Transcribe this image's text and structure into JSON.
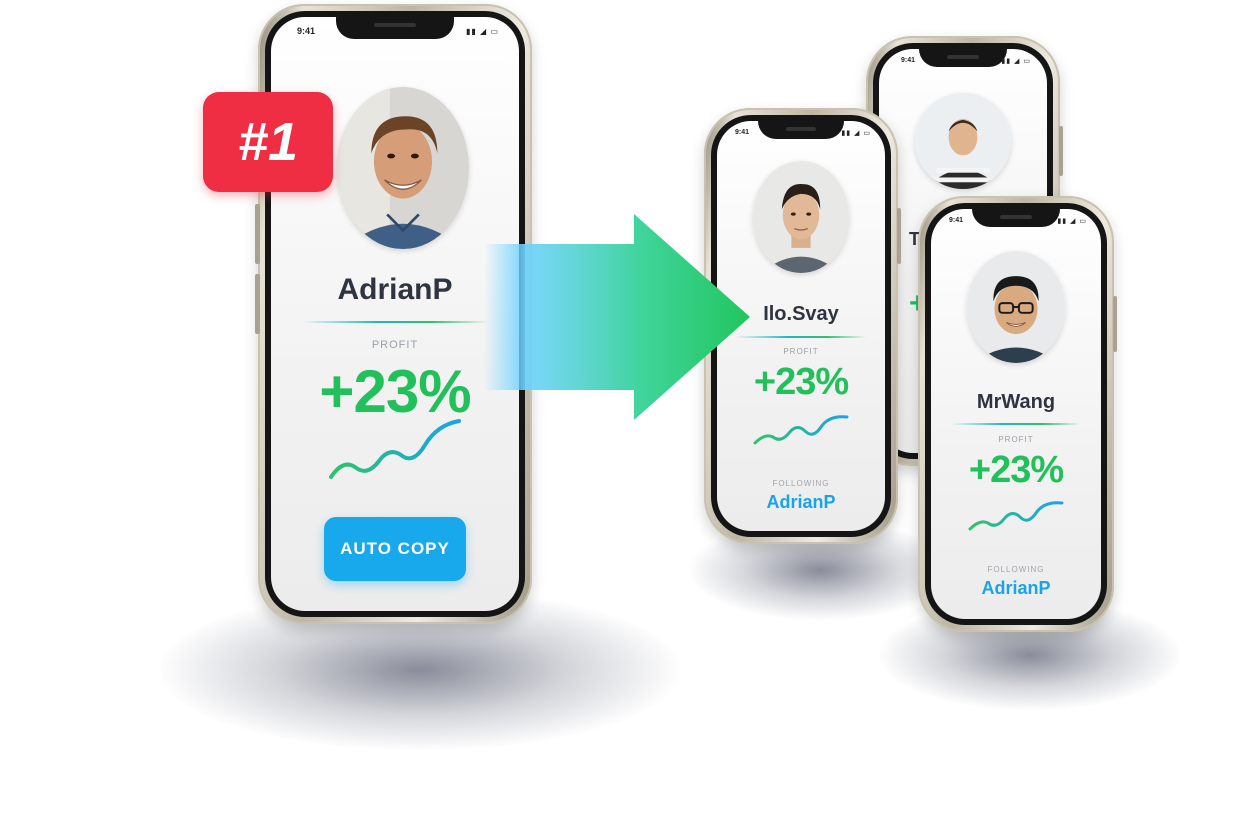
{
  "badge": {
    "label": "#1"
  },
  "status_time": "9:41",
  "leader": {
    "name": "AdrianP",
    "profit_label": "PROFIT",
    "profit_value": "+23%",
    "button_label": "AUTO COPY"
  },
  "followers": [
    {
      "name": "Ilo.Svay",
      "profit_label": "PROFIT",
      "profit_value": "+23%",
      "following_label": "FOLLOWING",
      "following_name": "AdrianP"
    },
    {
      "name": "T",
      "profit_value": "+"
    },
    {
      "name": "MrWang",
      "profit_label": "PROFIT",
      "profit_value": "+23%",
      "following_label": "FOLLOWING",
      "following_name": "AdrianP"
    }
  ],
  "colors": {
    "badge": "#ef2d43",
    "profit_green": "#22c05a",
    "accent_blue": "#18a8ec",
    "arrow_start": "#6ed2ff",
    "arrow_end": "#22c55e"
  }
}
